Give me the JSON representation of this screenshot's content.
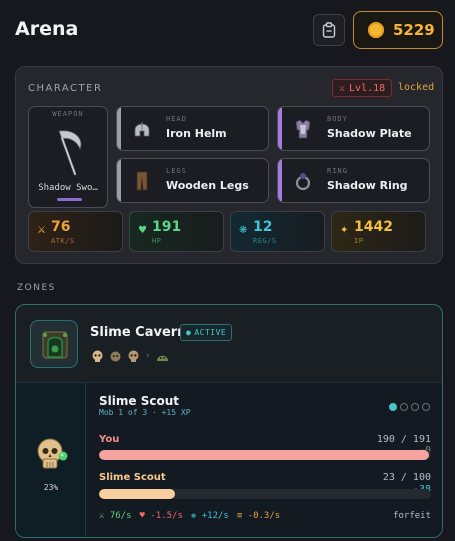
{
  "header": {
    "title": "Arena",
    "gold": "5229"
  },
  "character": {
    "section_label": "CHARACTER",
    "level_badge": "Lvl.18",
    "lock_status": "locked",
    "weapon": {
      "slot_label": "WEAPON",
      "name": "Shadow Swo…",
      "icon": "scythe-icon"
    },
    "slots": [
      {
        "slot_label": "HEAD",
        "name": "Iron Helm",
        "rarity_color": "#9aa0a8",
        "icon": "helm-icon"
      },
      {
        "slot_label": "BODY",
        "name": "Shadow Plate",
        "rarity_color": "#a57be0",
        "icon": "armor-icon"
      },
      {
        "slot_label": "LEGS",
        "name": "Wooden Legs",
        "rarity_color": "#9aa0a8",
        "icon": "legs-icon"
      },
      {
        "slot_label": "RING",
        "name": "Shadow Ring",
        "rarity_color": "#a57be0",
        "icon": "ring-icon"
      }
    ],
    "stats": [
      {
        "value": "76",
        "label": "ATK/S",
        "color": "#f0a23a",
        "icon": "swords-icon"
      },
      {
        "value": "191",
        "label": "HP",
        "color": "#5ed48a",
        "icon": "heart-icon"
      },
      {
        "value": "12",
        "label": "REG/S",
        "color": "#3fc4d6",
        "icon": "regen-icon"
      },
      {
        "value": "1442",
        "label": "IP",
        "color": "#f4bf3e",
        "icon": "star-icon"
      }
    ]
  },
  "zones": {
    "section_label": "ZONES",
    "zone": {
      "name": "Slime Cavern",
      "status": "ACTIVE",
      "battle": {
        "enemy_progress": "23%",
        "enemy_name": "Slime Scout",
        "mob_info": "Mob 1 of 3 · +15 XP",
        "mob_dots": [
          true,
          false,
          false,
          false
        ],
        "player": {
          "label": "You",
          "hp_text": "190 / 191",
          "delta": "-0",
          "fraction": 0.995,
          "color": "#f4a3a0"
        },
        "enemy": {
          "label": "Slime Scout",
          "hp_text": "23 / 100",
          "delta": "-38",
          "fraction": 0.23,
          "color": "#f8cf9e"
        },
        "rates": [
          {
            "text": "76/s",
            "color": "#5ed48a",
            "icon": "swords-icon"
          },
          {
            "text": "-1.5/s",
            "color": "#f06a6a",
            "icon": "heart-icon"
          },
          {
            "text": "+12/s",
            "color": "#3fc4d6",
            "icon": "regen-icon"
          },
          {
            "text": "-0.3/s",
            "color": "#e2a73d",
            "icon": "drain-icon"
          }
        ],
        "forfeit_label": "forfeit"
      }
    }
  }
}
